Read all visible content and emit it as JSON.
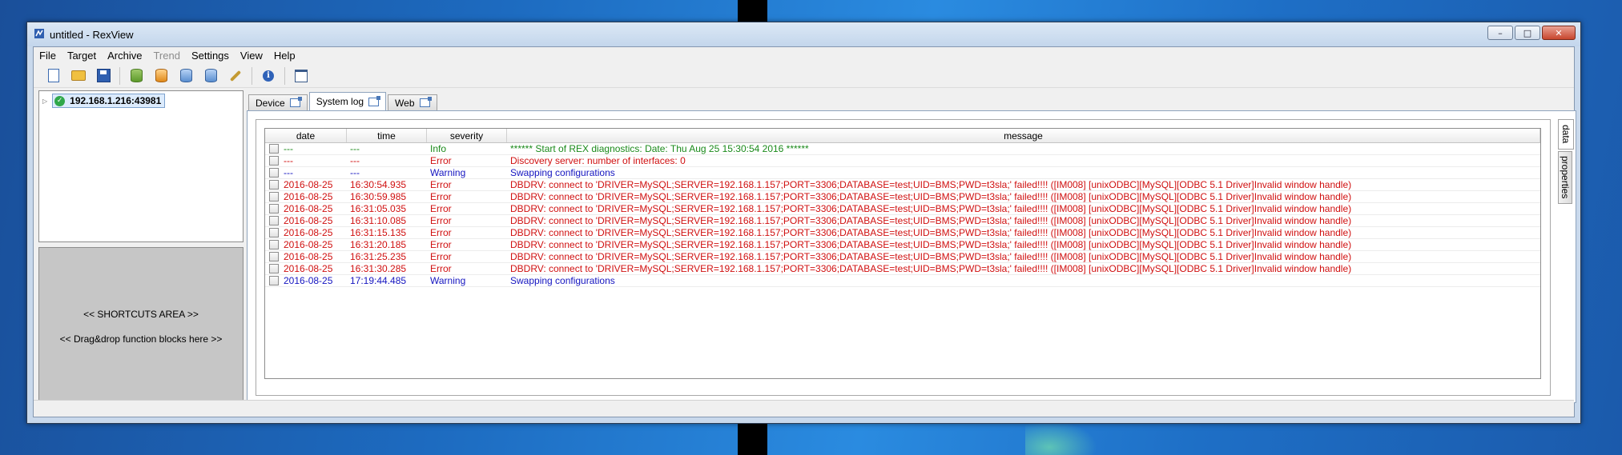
{
  "window": {
    "title": "untitled - RexView",
    "controls": {
      "minimize": "–",
      "maximize": "□",
      "close": "✕"
    }
  },
  "menu": [
    "File",
    "Target",
    "Archive",
    "Trend",
    "Settings",
    "View",
    "Help"
  ],
  "menu_disabled": [
    "Trend"
  ],
  "toolbar": {
    "icons": [
      "new-document-icon",
      "open-folder-icon",
      "save-icon",
      "connect-target-icon",
      "download-icon",
      "upload-icon",
      "diagnostics-icon",
      "wizard-icon",
      "info-icon",
      "window-icon"
    ],
    "info_glyph": "i"
  },
  "tree": {
    "expander": "▷",
    "status_glyph": "✓",
    "node_label": "192.168.1.216:43981"
  },
  "shortcuts": {
    "line1": "<< SHORTCUTS AREA >>",
    "line2": "<< Drag&drop function blocks here >>"
  },
  "tabs": [
    {
      "label": "Device",
      "active": false
    },
    {
      "label": "System log",
      "active": true
    },
    {
      "label": "Web",
      "active": false
    }
  ],
  "side_tabs": [
    {
      "label": "data",
      "active": true
    },
    {
      "label": "properties",
      "active": false
    }
  ],
  "log": {
    "columns": {
      "date": "date",
      "time": "time",
      "severity": "severity",
      "message": "message"
    },
    "rows": [
      {
        "date": "---",
        "time": "---",
        "severity": "Info",
        "message": "****** Start of REX diagnostics: Date: Thu Aug 25 15:30:54 2016 ******"
      },
      {
        "date": "---",
        "time": "---",
        "severity": "Error",
        "message": "Discovery server: number of interfaces: 0"
      },
      {
        "date": "---",
        "time": "---",
        "severity": "Warning",
        "message": "Swapping configurations"
      },
      {
        "date": "2016-08-25",
        "time": "16:30:54.935",
        "severity": "Error",
        "message": "DBDRV: connect to 'DRIVER=MySQL;SERVER=192.168.1.157;PORT=3306;DATABASE=test;UID=BMS;PWD=t3sla;' failed!!!! ([IM008] [unixODBC][MySQL][ODBC 5.1 Driver]Invalid window handle)"
      },
      {
        "date": "2016-08-25",
        "time": "16:30:59.985",
        "severity": "Error",
        "message": "DBDRV: connect to 'DRIVER=MySQL;SERVER=192.168.1.157;PORT=3306;DATABASE=test;UID=BMS;PWD=t3sla;' failed!!!! ([IM008] [unixODBC][MySQL][ODBC 5.1 Driver]Invalid window handle)"
      },
      {
        "date": "2016-08-25",
        "time": "16:31:05.035",
        "severity": "Error",
        "message": "DBDRV: connect to 'DRIVER=MySQL;SERVER=192.168.1.157;PORT=3306;DATABASE=test;UID=BMS;PWD=t3sla;' failed!!!! ([IM008] [unixODBC][MySQL][ODBC 5.1 Driver]Invalid window handle)"
      },
      {
        "date": "2016-08-25",
        "time": "16:31:10.085",
        "severity": "Error",
        "message": "DBDRV: connect to 'DRIVER=MySQL;SERVER=192.168.1.157;PORT=3306;DATABASE=test;UID=BMS;PWD=t3sla;' failed!!!! ([IM008] [unixODBC][MySQL][ODBC 5.1 Driver]Invalid window handle)"
      },
      {
        "date": "2016-08-25",
        "time": "16:31:15.135",
        "severity": "Error",
        "message": "DBDRV: connect to 'DRIVER=MySQL;SERVER=192.168.1.157;PORT=3306;DATABASE=test;UID=BMS;PWD=t3sla;' failed!!!! ([IM008] [unixODBC][MySQL][ODBC 5.1 Driver]Invalid window handle)"
      },
      {
        "date": "2016-08-25",
        "time": "16:31:20.185",
        "severity": "Error",
        "message": "DBDRV: connect to 'DRIVER=MySQL;SERVER=192.168.1.157;PORT=3306;DATABASE=test;UID=BMS;PWD=t3sla;' failed!!!! ([IM008] [unixODBC][MySQL][ODBC 5.1 Driver]Invalid window handle)"
      },
      {
        "date": "2016-08-25",
        "time": "16:31:25.235",
        "severity": "Error",
        "message": "DBDRV: connect to 'DRIVER=MySQL;SERVER=192.168.1.157;PORT=3306;DATABASE=test;UID=BMS;PWD=t3sla;' failed!!!! ([IM008] [unixODBC][MySQL][ODBC 5.1 Driver]Invalid window handle)"
      },
      {
        "date": "2016-08-25",
        "time": "16:31:30.285",
        "severity": "Error",
        "message": "DBDRV: connect to 'DRIVER=MySQL;SERVER=192.168.1.157;PORT=3306;DATABASE=test;UID=BMS;PWD=t3sla;' failed!!!! ([IM008] [unixODBC][MySQL][ODBC 5.1 Driver]Invalid window handle)"
      },
      {
        "date": "2016-08-25",
        "time": "17:19:44.485",
        "severity": "Warning",
        "message": "Swapping configurations"
      }
    ]
  },
  "colors": {
    "info": "#1a8a1a",
    "error": "#d01010",
    "warning": "#1515c0",
    "status_ok": "#2fa84a"
  }
}
